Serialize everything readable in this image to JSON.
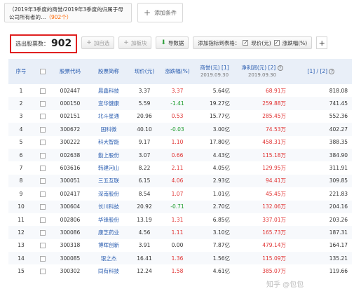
{
  "conditions": {
    "tag_text": "（2019年3季度的商誉/2019年3季度的归属于母公司所有者的…",
    "tag_count": "（902个）",
    "add_label": "添加条件"
  },
  "toolbar": {
    "result_label": "选出股票数：",
    "result_count": "902",
    "add_watch": "加自选",
    "add_block": "加板块",
    "export": "导数据",
    "add_indicator": "添加指标到表格：",
    "price_opt": "现价(元)",
    "change_opt": "涨跌幅(%)",
    "plus": "+"
  },
  "table": {
    "headers": {
      "index": "序号",
      "code": "股票代码",
      "name": "股票简称",
      "price": "现价(元)",
      "change": "涨跌幅(%)",
      "goodwill": "商誉(元) [1]",
      "goodwill_date": "2019.09.30",
      "profit": "净利润(元) [2]",
      "profit_date": "2019.09.30",
      "ratio": "[1] / [2]"
    },
    "rows": [
      {
        "idx": "1",
        "code": "002447",
        "name": "晨鑫科技",
        "price": "3.37",
        "change": "3.37",
        "dir": "up",
        "goodwill": "5.64亿",
        "profit": "68.91万",
        "ratio": "818.08"
      },
      {
        "idx": "2",
        "code": "000150",
        "name": "宜华健康",
        "price": "5.59",
        "change": "-1.41",
        "dir": "down",
        "goodwill": "19.27亿",
        "profit": "259.88万",
        "ratio": "741.45"
      },
      {
        "idx": "3",
        "code": "002151",
        "name": "北斗星通",
        "price": "20.96",
        "change": "0.53",
        "dir": "up",
        "goodwill": "15.77亿",
        "profit": "285.45万",
        "ratio": "552.36"
      },
      {
        "idx": "4",
        "code": "300672",
        "name": "国科微",
        "price": "40.10",
        "change": "-0.03",
        "dir": "down",
        "goodwill": "3.00亿",
        "profit": "74.53万",
        "ratio": "402.27"
      },
      {
        "idx": "5",
        "code": "300222",
        "name": "科大智能",
        "price": "9.17",
        "change": "1.10",
        "dir": "up",
        "goodwill": "17.80亿",
        "profit": "458.31万",
        "ratio": "388.35"
      },
      {
        "idx": "6",
        "code": "002638",
        "name": "勤上股份",
        "price": "3.07",
        "change": "0.66",
        "dir": "up",
        "goodwill": "4.43亿",
        "profit": "115.18万",
        "ratio": "384.90"
      },
      {
        "idx": "7",
        "code": "603616",
        "name": "韩建河山",
        "price": "8.22",
        "change": "2.11",
        "dir": "up",
        "goodwill": "4.05亿",
        "profit": "129.95万",
        "ratio": "311.91"
      },
      {
        "idx": "8",
        "code": "300051",
        "name": "三五互联",
        "price": "6.15",
        "change": "4.06",
        "dir": "up",
        "goodwill": "2.93亿",
        "profit": "94.41万",
        "ratio": "309.85"
      },
      {
        "idx": "9",
        "code": "002417",
        "name": "深南股份",
        "price": "8.54",
        "change": "1.07",
        "dir": "up",
        "goodwill": "1.01亿",
        "profit": "45.45万",
        "ratio": "221.83"
      },
      {
        "idx": "10",
        "code": "300604",
        "name": "长川科技",
        "price": "20.92",
        "change": "-0.71",
        "dir": "down",
        "goodwill": "2.70亿",
        "profit": "132.06万",
        "ratio": "204.16"
      },
      {
        "idx": "11",
        "code": "002806",
        "name": "华锋股份",
        "price": "13.19",
        "change": "1.31",
        "dir": "up",
        "goodwill": "6.85亿",
        "profit": "337.01万",
        "ratio": "203.26"
      },
      {
        "idx": "12",
        "code": "300086",
        "name": "康芝药业",
        "price": "4.56",
        "change": "1.11",
        "dir": "up",
        "goodwill": "3.10亿",
        "profit": "165.73万",
        "ratio": "187.31"
      },
      {
        "idx": "13",
        "code": "300318",
        "name": "博晖创新",
        "price": "3.91",
        "change": "0.00",
        "dir": "flat",
        "goodwill": "7.87亿",
        "profit": "479.14万",
        "ratio": "164.17"
      },
      {
        "idx": "14",
        "code": "300085",
        "name": "银之杰",
        "price": "16.41",
        "change": "1.36",
        "dir": "up",
        "goodwill": "1.56亿",
        "profit": "115.09万",
        "ratio": "135.21"
      },
      {
        "idx": "15",
        "code": "300302",
        "name": "同有科技",
        "price": "12.24",
        "change": "1.58",
        "dir": "up",
        "goodwill": "4.61亿",
        "profit": "385.07万",
        "ratio": "119.66"
      }
    ]
  },
  "watermark": "知乎 @包包"
}
